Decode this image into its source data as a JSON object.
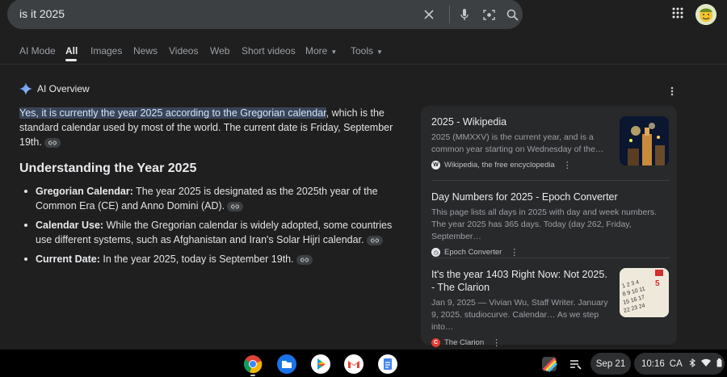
{
  "search": {
    "query": "is it 2025"
  },
  "tabs": [
    {
      "label": "AI Mode"
    },
    {
      "label": "All"
    },
    {
      "label": "Images"
    },
    {
      "label": "News"
    },
    {
      "label": "Videos"
    },
    {
      "label": "Web"
    },
    {
      "label": "Short videos"
    },
    {
      "label": "More"
    },
    {
      "label": "Tools"
    }
  ],
  "ai_overview": {
    "label": "AI Overview",
    "answer_highlight": "Yes, it is currently the year 2025 according to the Gregorian calendar",
    "answer_rest": ", which is the standard calendar used by most of the world. The current date is Friday, September 19th.",
    "heading": "Understanding the Year 2025",
    "bullets": [
      {
        "term": "Gregorian Calendar:",
        "text": " The year 2025 is designated as the 2025th year of the Common Era (CE) and Anno Domini (AD)."
      },
      {
        "term": "Calendar Use:",
        "text": " While the Gregorian calendar is widely adopted, some countries use different systems, such as Afghanistan and Iran's Solar Hijri calendar."
      },
      {
        "term": "Current Date:",
        "text": " In the year 2025, today is September 19th."
      }
    ]
  },
  "sources": [
    {
      "title": "2025 - Wikipedia",
      "snippet": "2025 (MMXXV) is the current year, and is a common year starting on Wednesday of the…",
      "site": "Wikipedia, the free encyclopedia"
    },
    {
      "title": "Day Numbers for 2025 - Epoch Converter",
      "snippet": "This page lists all days in 2025 with day and week numbers. The year 2025 has 365 days. Today (day 262, Friday, September…",
      "site": "Epoch Converter"
    },
    {
      "title": "It's the year 1403 Right Now: Not 2025. - The Clarion",
      "snippet": "Jan 9, 2025 — Vivian Wu, Staff Writer. January 9, 2025. studiocurve. Calendar… As we step into…",
      "site": "The Clarion"
    }
  ],
  "shelf": {
    "date": "Sep 21",
    "time": "10:16",
    "region": "CA"
  },
  "colors": {
    "accent_highlight": "#394457",
    "panel": "#28292a",
    "background": "#1f1f1f"
  }
}
